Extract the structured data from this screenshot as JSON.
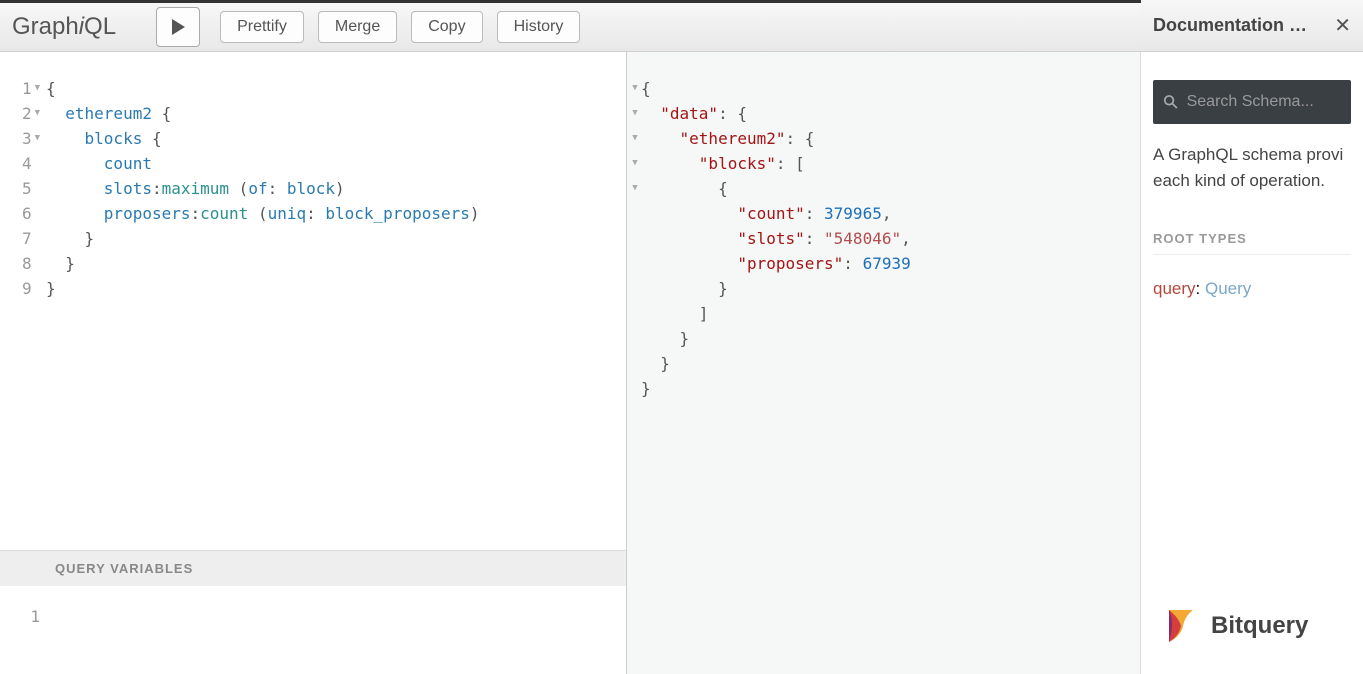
{
  "app": {
    "name": "GraphiQL"
  },
  "toolbar": {
    "prettify": "Prettify",
    "merge": "Merge",
    "copy": "Copy",
    "history": "History"
  },
  "query": {
    "lines": [
      "1",
      "2",
      "3",
      "4",
      "5",
      "6",
      "7",
      "8",
      "9"
    ],
    "tokens": [
      [
        {
          "t": "{",
          "c": "punc"
        }
      ],
      [
        {
          "t": "  ",
          "c": ""
        },
        {
          "t": "ethereum2",
          "c": "kw"
        },
        {
          "t": " {",
          "c": "punc"
        }
      ],
      [
        {
          "t": "    ",
          "c": ""
        },
        {
          "t": "blocks",
          "c": "kw"
        },
        {
          "t": " {",
          "c": "punc"
        }
      ],
      [
        {
          "t": "      ",
          "c": ""
        },
        {
          "t": "count",
          "c": "kw"
        }
      ],
      [
        {
          "t": "      ",
          "c": ""
        },
        {
          "t": "slots",
          "c": "kw"
        },
        {
          "t": ":",
          "c": "punc"
        },
        {
          "t": "maximum",
          "c": "fn"
        },
        {
          "t": " (",
          "c": "punc"
        },
        {
          "t": "of",
          "c": "arg"
        },
        {
          "t": ": ",
          "c": "punc"
        },
        {
          "t": "block",
          "c": "kw"
        },
        {
          "t": ")",
          "c": "punc"
        }
      ],
      [
        {
          "t": "      ",
          "c": ""
        },
        {
          "t": "proposers",
          "c": "kw"
        },
        {
          "t": ":",
          "c": "punc"
        },
        {
          "t": "count",
          "c": "fn"
        },
        {
          "t": " (",
          "c": "punc"
        },
        {
          "t": "uniq",
          "c": "arg"
        },
        {
          "t": ": ",
          "c": "punc"
        },
        {
          "t": "block_proposers",
          "c": "kw"
        },
        {
          "t": ")",
          "c": "punc"
        }
      ],
      [
        {
          "t": "    }",
          "c": "punc"
        }
      ],
      [
        {
          "t": "  }",
          "c": "punc"
        }
      ],
      [
        {
          "t": "}",
          "c": "punc"
        }
      ]
    ],
    "foldable": [
      true,
      true,
      true,
      false,
      false,
      false,
      false,
      false,
      false
    ]
  },
  "query_variables": {
    "label": "QUERY VARIABLES",
    "lines": [
      "1"
    ]
  },
  "result": {
    "tokens": [
      [
        {
          "t": "{",
          "c": "punc"
        }
      ],
      [
        {
          "t": "  ",
          "c": ""
        },
        {
          "t": "\"data\"",
          "c": "jkey"
        },
        {
          "t": ": {",
          "c": "punc"
        }
      ],
      [
        {
          "t": "    ",
          "c": ""
        },
        {
          "t": "\"ethereum2\"",
          "c": "jkey"
        },
        {
          "t": ": {",
          "c": "punc"
        }
      ],
      [
        {
          "t": "      ",
          "c": ""
        },
        {
          "t": "\"blocks\"",
          "c": "jkey"
        },
        {
          "t": ": [",
          "c": "punc"
        }
      ],
      [
        {
          "t": "        {",
          "c": "punc"
        }
      ],
      [
        {
          "t": "          ",
          "c": ""
        },
        {
          "t": "\"count\"",
          "c": "jkey"
        },
        {
          "t": ": ",
          "c": "punc"
        },
        {
          "t": "379965",
          "c": "jnum"
        },
        {
          "t": ",",
          "c": "punc"
        }
      ],
      [
        {
          "t": "          ",
          "c": ""
        },
        {
          "t": "\"slots\"",
          "c": "jkey"
        },
        {
          "t": ": ",
          "c": "punc"
        },
        {
          "t": "\"548046\"",
          "c": "jstr"
        },
        {
          "t": ",",
          "c": "punc"
        }
      ],
      [
        {
          "t": "          ",
          "c": ""
        },
        {
          "t": "\"proposers\"",
          "c": "jkey"
        },
        {
          "t": ": ",
          "c": "punc"
        },
        {
          "t": "67939",
          "c": "jnum"
        }
      ],
      [
        {
          "t": "        }",
          "c": "punc"
        }
      ],
      [
        {
          "t": "      ]",
          "c": "punc"
        }
      ],
      [
        {
          "t": "    }",
          "c": "punc"
        }
      ],
      [
        {
          "t": "  }",
          "c": "punc"
        }
      ],
      [
        {
          "t": "}",
          "c": "punc"
        }
      ]
    ],
    "foldable": [
      true,
      true,
      true,
      true,
      true,
      false,
      false,
      false,
      false,
      false,
      false,
      false,
      false
    ]
  },
  "doc": {
    "title": "Documentation E…",
    "search_placeholder": "Search Schema...",
    "description": "A GraphQL schema provi each kind of operation.",
    "root_types_label": "ROOT TYPES",
    "root": {
      "key": "query",
      "type": "Query"
    }
  },
  "brand": {
    "name": "Bitquery"
  }
}
